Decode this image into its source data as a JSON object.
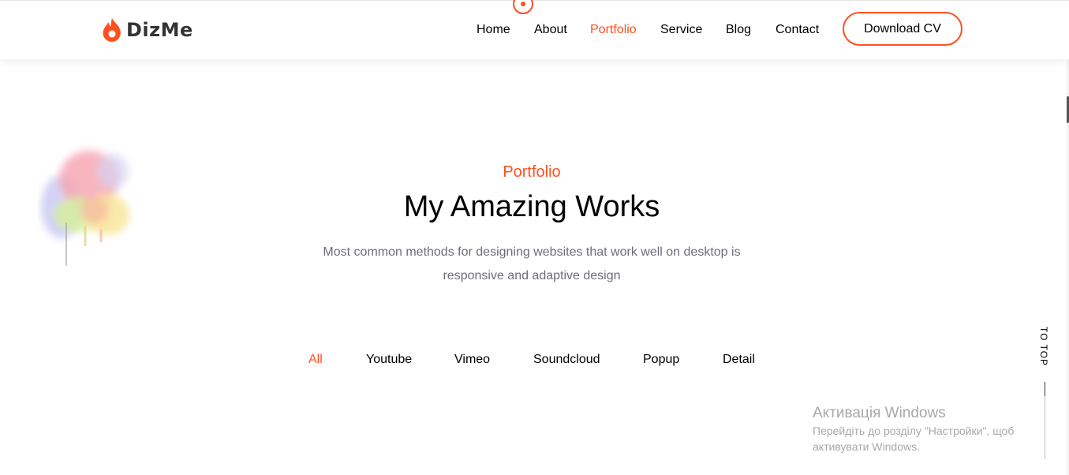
{
  "header": {
    "logo_text": "DizMe",
    "nav": [
      {
        "label": "Home",
        "active": false
      },
      {
        "label": "About",
        "active": false
      },
      {
        "label": "Portfolio",
        "active": true
      },
      {
        "label": "Service",
        "active": false
      },
      {
        "label": "Blog",
        "active": false
      },
      {
        "label": "Contact",
        "active": false
      }
    ],
    "cta_label": "Download CV"
  },
  "section": {
    "label": "Portfolio",
    "title": "My Amazing Works",
    "description": "Most common methods for designing websites that work well on desktop is responsive and adaptive design"
  },
  "filters": [
    {
      "label": "All",
      "active": true
    },
    {
      "label": "Youtube",
      "active": false
    },
    {
      "label": "Vimeo",
      "active": false
    },
    {
      "label": "Soundcloud",
      "active": false
    },
    {
      "label": "Popup",
      "active": false
    },
    {
      "label": "Detail",
      "active": false
    }
  ],
  "totop_label": "TO TOP",
  "windows_activation": {
    "title": "Активація Windows",
    "line1": "Перейдіть до розділу \"Настройки\", щоб",
    "line2": "активувати Windows."
  },
  "colors": {
    "accent": "#ff4f1f",
    "text_muted": "#6f6c7a"
  }
}
